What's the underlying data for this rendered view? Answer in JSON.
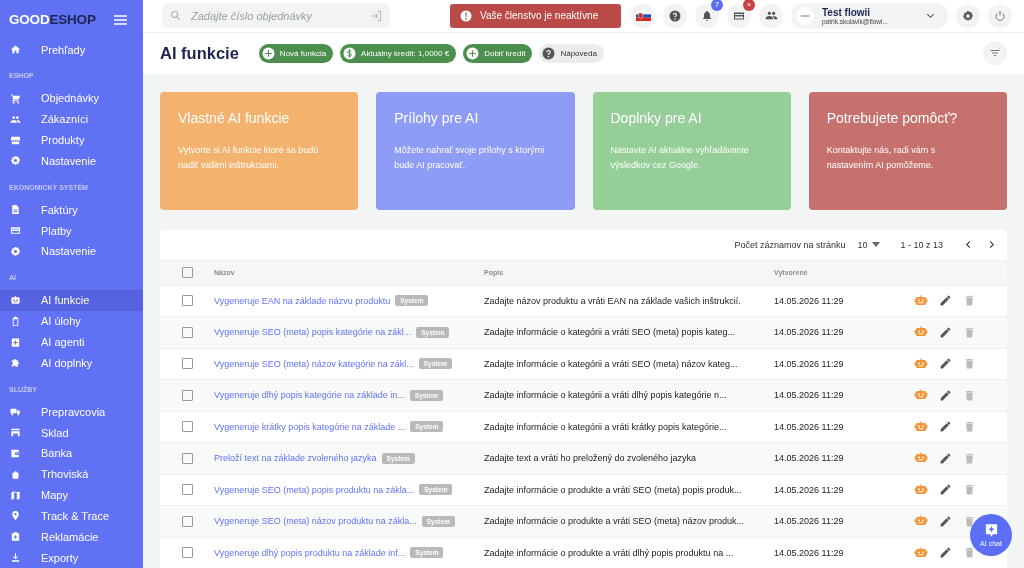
{
  "sidebar": {
    "logo": {
      "first": "GOOD",
      "second": "ESHOP"
    },
    "sections": [
      {
        "items": [
          {
            "label": "Prehľady",
            "selected": false
          }
        ]
      },
      {
        "heading": "ESHOP",
        "items": [
          {
            "label": "Objednávky",
            "selected": false
          },
          {
            "label": "Zákazníci",
            "selected": false
          },
          {
            "label": "Produkty",
            "selected": false
          },
          {
            "label": "Nastavenie",
            "selected": false
          }
        ]
      },
      {
        "heading": "EKONOMICKÝ SYSTÉM",
        "items": [
          {
            "label": "Faktúry",
            "selected": false
          },
          {
            "label": "Platby",
            "selected": false
          },
          {
            "label": "Nastavenie",
            "selected": false
          }
        ]
      },
      {
        "heading": "AI",
        "items": [
          {
            "label": "AI funkcie",
            "selected": true
          },
          {
            "label": "AI úlohy",
            "selected": false
          },
          {
            "label": "AI agenti",
            "selected": false
          },
          {
            "label": "AI doplnky",
            "selected": false
          }
        ]
      },
      {
        "heading": "SLUŽBY",
        "items": [
          {
            "label": "Prepravcovia",
            "selected": false
          },
          {
            "label": "Sklad",
            "selected": false
          },
          {
            "label": "Banka",
            "selected": false
          },
          {
            "label": "Trhoviská",
            "selected": false
          },
          {
            "label": "Mapy",
            "selected": false
          },
          {
            "label": "Track & Trace",
            "selected": false
          },
          {
            "label": "Reklamácie",
            "selected": false
          },
          {
            "label": "Exporty",
            "selected": false
          }
        ]
      }
    ]
  },
  "topbar": {
    "search": {
      "placeholder": "Zadajte číslo objednávky"
    },
    "alert": "Vaše členstvo je neaktívne",
    "notifications_badge": "7",
    "payments_badge": "×",
    "user": {
      "name": "Test flowii",
      "email": "patrik.skulavik@flowi..."
    }
  },
  "header": {
    "title": "AI funkcie",
    "buttons": [
      {
        "label": "Nová funkcia",
        "kind": "add"
      },
      {
        "label": "Aktuálny kredit: 1,0000 €",
        "kind": "credit"
      },
      {
        "label": "Dobiť kredit",
        "kind": "add"
      },
      {
        "label": "Nápoveda",
        "kind": "help"
      }
    ]
  },
  "cards": [
    {
      "title": "Vlastné AI funkcie",
      "text": "Vytvorte si AI funkcie ktoré sa budú riadiť vašimi inštrukciami.",
      "color": "#f4b26f"
    },
    {
      "title": "Prílohy pre AI",
      "text": "Môžete nahrať svoje prílohy s ktorými bude AI pracovať.",
      "color": "#8f9cf6"
    },
    {
      "title": "Doplnky pre AI",
      "text": "Nastavte AI aktuálne vyhľadávanie výsledkov cez Google.",
      "color": "#96ce98"
    },
    {
      "title": "Potrebujete pomôcť?",
      "text": "Kontaktujte nás, radi vám s nastavením AI pomôžeme.",
      "color": "#c6716d"
    }
  ],
  "table": {
    "per_page_label": "Počet záznamov na stránku",
    "per_page": "10",
    "range": "1 - 10 z 13",
    "columns": [
      "Názov",
      "Popis",
      "Vytvorené"
    ],
    "all_checked": false,
    "rows": [
      {
        "name": "Vygeneruje EAN na základe názvu produktu",
        "tag": "System",
        "description": "Zadajte názov produktu a vráti EAN na základe vašich inštrukcií.",
        "created": "14.05.2026 11:29",
        "checked": false
      },
      {
        "name": "Vygeneruje SEO (meta) popis kategórie na zákl...",
        "tag": "System",
        "description": "Zadajte informácie o kategórii a vráti SEO (meta) popis kateg...",
        "created": "14.05.2026 11:29",
        "checked": false
      },
      {
        "name": "Vygeneruje SEO (meta) názov kategórie na zákl...",
        "tag": "System",
        "description": "Zadajte informácie o kategórii a vráti SEO (meta) názov kateg...",
        "created": "14.05.2026 11:29",
        "checked": false
      },
      {
        "name": "Vygeneruje dlhý popis kategórie na základe in...",
        "tag": "System",
        "description": "Zadajte informácie o kategórii a vráti dlhý popis kategórie n...",
        "created": "14.05.2026 11:29",
        "checked": false
      },
      {
        "name": "Vygeneruje krátky popis kategórie na základe ...",
        "tag": "System",
        "description": "Zadajte informácie o kategórii a vráti krátky popis kategórie...",
        "created": "14.05.2026 11:29",
        "checked": false
      },
      {
        "name": "Preloží text na základe zvoleného jazyka",
        "tag": "System",
        "description": "Zadajte text a vráti ho preložený do zvoleného jazyka",
        "created": "14.05.2026 11:29",
        "checked": false
      },
      {
        "name": "Vygeneruje SEO (meta) popis produktu na zákla...",
        "tag": "System",
        "description": "Zadajte informácie o produkte a vráti SEO (meta) popis produk...",
        "created": "14.05.2026 11:29",
        "checked": false
      },
      {
        "name": "Vygeneruje SEO (meta) názov produktu na zákla...",
        "tag": "System",
        "description": "Zadajte informácie o produkte a vráti SEO (meta) názov produk...",
        "created": "14.05.2026 11:29",
        "checked": false
      },
      {
        "name": "Vygeneruje dlhý popis produktu na základe inf...",
        "tag": "System",
        "description": "Zadajte informácie o produkte a vráti dlhý popis produktu na ...",
        "created": "14.05.2026 11:29",
        "checked": false
      }
    ]
  },
  "chat_button": "AI chat"
}
